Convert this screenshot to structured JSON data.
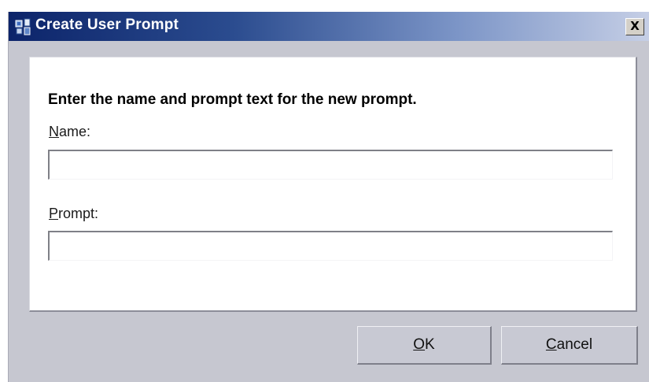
{
  "window": {
    "title": "Create User Prompt",
    "close_label": "X"
  },
  "form": {
    "instruction": "Enter the name and prompt text for the new prompt.",
    "name_label_mnemonic": "N",
    "name_label_rest": "ame:",
    "name_value": "",
    "prompt_label_mnemonic": "P",
    "prompt_label_rest": "rompt:",
    "prompt_value": ""
  },
  "buttons": {
    "ok_mnemonic": "O",
    "ok_rest": "K",
    "cancel_mnemonic": "C",
    "cancel_rest": "ancel"
  },
  "colors": {
    "titlebar_start": "#0c246a",
    "titlebar_end": "#c6cfe6",
    "dialog_background": "#c6c7d0",
    "panel_background": "#ffffff"
  },
  "icons": {
    "app_icon": "user-prompt-app-icon",
    "close_icon": "close-icon"
  }
}
